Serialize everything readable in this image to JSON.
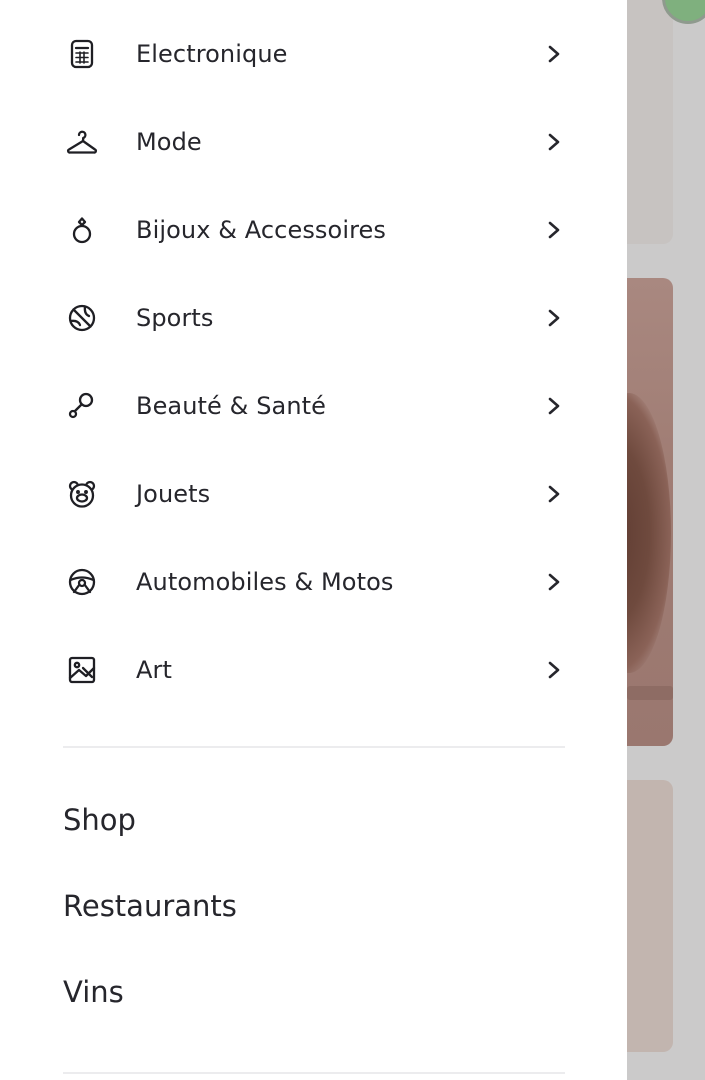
{
  "drawer": {
    "categories": [
      {
        "label": "Electronique",
        "icon": "calculator-icon"
      },
      {
        "label": "Mode",
        "icon": "hanger-icon"
      },
      {
        "label": "Bijoux & Accessoires",
        "icon": "ring-icon"
      },
      {
        "label": "Sports",
        "icon": "ball-icon"
      },
      {
        "label": "Beauté & Santé",
        "icon": "beauty-tool-icon"
      },
      {
        "label": "Jouets",
        "icon": "teddy-bear-icon"
      },
      {
        "label": "Automobiles & Motos",
        "icon": "steering-wheel-icon"
      },
      {
        "label": "Art",
        "icon": "image-icon"
      }
    ],
    "links": [
      {
        "label": "Shop"
      },
      {
        "label": "Restaurants"
      },
      {
        "label": "Vins"
      }
    ]
  }
}
